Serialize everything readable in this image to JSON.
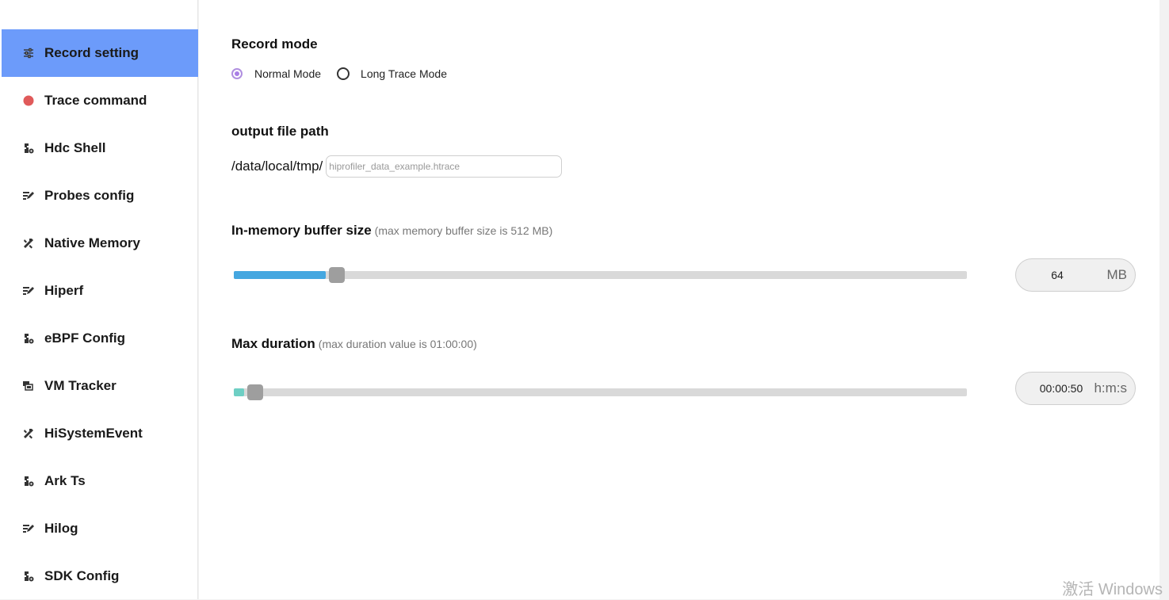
{
  "sidebar": {
    "items": [
      {
        "label": "Record setting",
        "icon": "settings-sliders-icon",
        "active": true
      },
      {
        "label": "Trace command",
        "icon": "red-dot-icon",
        "active": false
      },
      {
        "label": "Hdc Shell",
        "icon": "puzzle-gear-icon",
        "active": false
      },
      {
        "label": "Probes config",
        "icon": "edit-list-icon",
        "active": false
      },
      {
        "label": "Native Memory",
        "icon": "tools-icon",
        "active": false
      },
      {
        "label": "Hiperf",
        "icon": "edit-list-icon",
        "active": false
      },
      {
        "label": "eBPF Config",
        "icon": "puzzle-gear-icon",
        "active": false
      },
      {
        "label": "VM Tracker",
        "icon": "device-stack-icon",
        "active": false
      },
      {
        "label": "HiSystemEvent",
        "icon": "tools-icon",
        "active": false
      },
      {
        "label": "Ark Ts",
        "icon": "puzzle-gear-icon",
        "active": false
      },
      {
        "label": "Hilog",
        "icon": "edit-list-icon",
        "active": false
      },
      {
        "label": "SDK Config",
        "icon": "puzzle-gear-icon",
        "active": false
      }
    ]
  },
  "record_mode": {
    "title": "Record mode",
    "options": [
      {
        "label": "Normal Mode",
        "checked": true
      },
      {
        "label": "Long Trace Mode",
        "checked": false
      }
    ]
  },
  "output": {
    "title": "output file path",
    "prefix": "/data/local/tmp/",
    "placeholder": "hiprofiler_data_example.htrace",
    "value": ""
  },
  "buffer": {
    "title": "In-memory buffer size",
    "hint": "(max memory buffer size is 512 MB)",
    "value": "64",
    "unit": "MB",
    "fill_fraction": 0.125,
    "fill_color": "#45a7e0"
  },
  "duration": {
    "title": "Max duration",
    "hint": "(max duration value is 01:00:00)",
    "value": "00:00:50",
    "unit": "h:m:s",
    "fill_fraction": 0.014,
    "fill_color": "#6ecfc4"
  },
  "colors": {
    "active_item": "#6c9bfa",
    "radio_checked": "#a97ee6"
  },
  "watermark": "激活 Windows"
}
